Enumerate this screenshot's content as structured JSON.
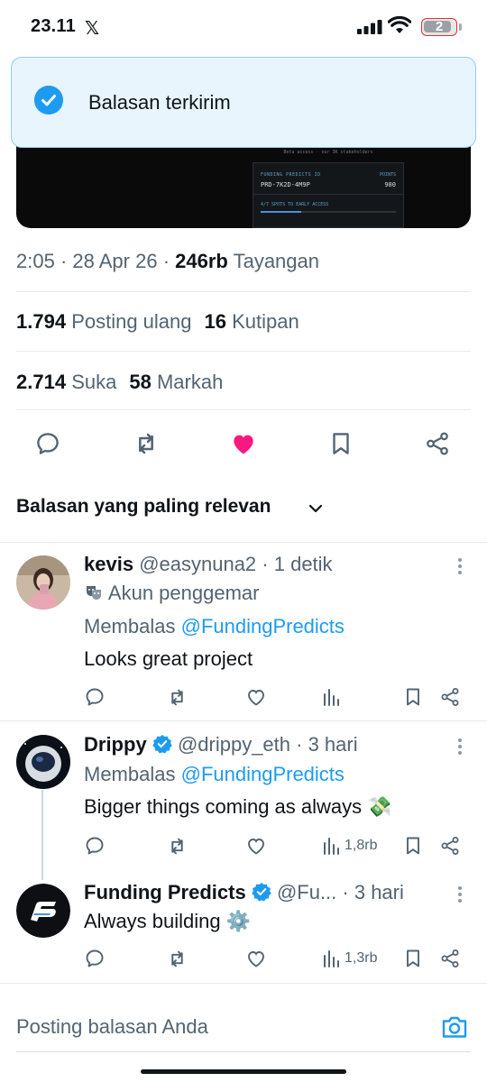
{
  "status_bar": {
    "time": "23.11",
    "x_logo": "𝕏",
    "battery": "2"
  },
  "media": {
    "top_text": "Beta access · our 3K stakeholders",
    "label_left": "FUNDING PREDICTS ID",
    "label_right": "POINTS",
    "code": "PRD-7K2D-4M9P",
    "points": "980",
    "access": "4/7 SPOTS TO EARLY ACCESS",
    "progress": 0.3
  },
  "toast": {
    "text": "Balasan terkirim"
  },
  "post_meta": {
    "time": "2:05",
    "date": "28 Apr 26",
    "views_count": "246rb",
    "views_label": "Tayangan"
  },
  "stats": {
    "reposts_count": "1.794",
    "reposts_label": "Posting ulang",
    "quotes_count": "16",
    "quotes_label": "Kutipan",
    "likes_count": "2.714",
    "likes_label": "Suka",
    "bookmarks_count": "58",
    "bookmarks_label": "Markah"
  },
  "colors": {
    "like_active": "#f91880",
    "accent": "#1d9bf0"
  },
  "replies_section": {
    "title": "Balasan yang paling relevan"
  },
  "replies": [
    {
      "name": "kevis",
      "handle": "@easynuna2",
      "time": "1 detik",
      "badge_icon": "theater-masks-icon",
      "badge": "Akun penggemar",
      "replying_prefix": "Membalas",
      "replying_to": "@FundingPredicts",
      "text": "Looks great project",
      "views": ""
    },
    {
      "name": "Drippy",
      "verified": true,
      "handle": "@drippy_eth",
      "time": "3 hari",
      "replying_prefix": "Membalas",
      "replying_to": "@FundingPredicts",
      "text": "Bigger things coming as always 💸",
      "views": "1,8rb"
    },
    {
      "name": "Funding Predicts",
      "verified": true,
      "handle": "@Fu...",
      "time": "3 hari",
      "text": "Always building ⚙️",
      "views": "1,3rb"
    }
  ],
  "composer": {
    "placeholder": "Posting balasan Anda"
  }
}
